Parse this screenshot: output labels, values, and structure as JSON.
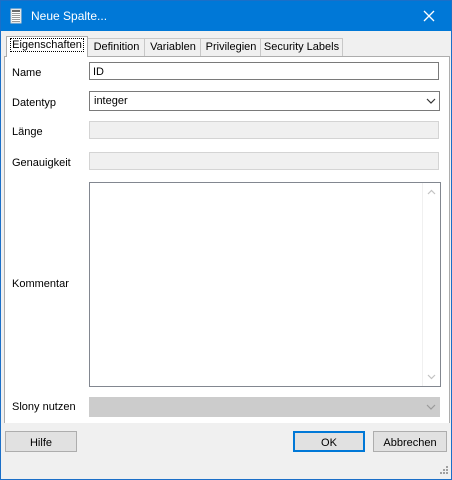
{
  "window": {
    "title": "Neue Spalte..."
  },
  "tabs": [
    {
      "label": "Eigenschaften"
    },
    {
      "label": "Definition"
    },
    {
      "label": "Variablen"
    },
    {
      "label": "Privilegien"
    },
    {
      "label": "Security Labels"
    }
  ],
  "form": {
    "name": {
      "label": "Name",
      "value": "ID"
    },
    "datentyp": {
      "label": "Datentyp",
      "value": "integer"
    },
    "laenge": {
      "label": "Länge",
      "value": ""
    },
    "genauigkeit": {
      "label": "Genauigkeit",
      "value": ""
    },
    "kommentar": {
      "label": "Kommentar",
      "value": ""
    },
    "slony": {
      "label": "Slony nutzen",
      "value": ""
    }
  },
  "buttons": {
    "help": "Hilfe",
    "ok": "OK",
    "cancel": "Abbrechen"
  },
  "colors": {
    "titlebar": "#0078d7",
    "accent": "#0078d7"
  }
}
